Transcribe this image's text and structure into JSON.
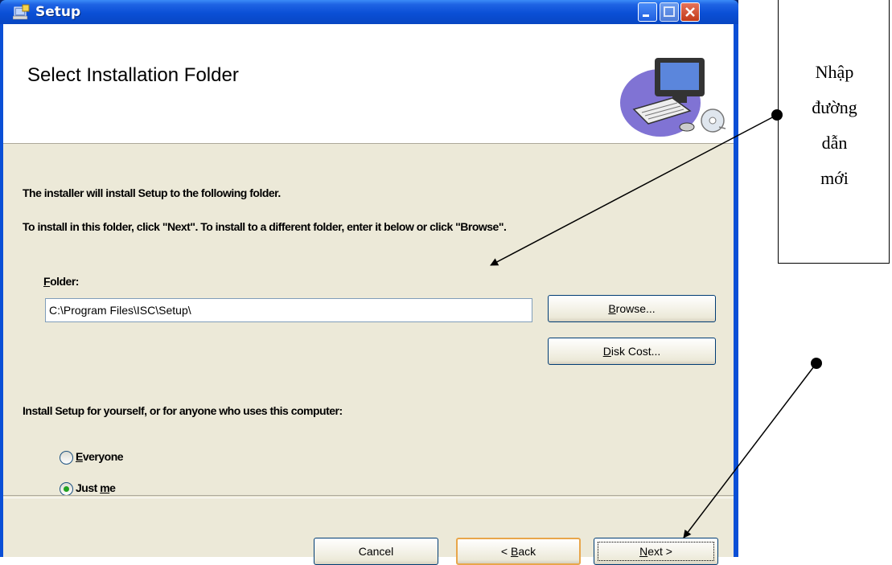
{
  "window": {
    "title": "Setup",
    "banner_title": "Select Installation Folder",
    "intro_line_1": "The installer will install Setup to the following folder.",
    "intro_line_2": "To install in this folder, click \"Next\". To install to a different folder, enter it below or click \"Browse\".",
    "folder_label_accel": "F",
    "folder_label_rest": "older:",
    "folder_value": "C:\\Program Files\\ISC\\Setup\\",
    "browse_accel": "B",
    "browse_rest": "rowse...",
    "diskcost_accel": "D",
    "diskcost_rest": "isk Cost...",
    "install_for_text": "Install Setup for yourself, or for anyone who uses this computer:",
    "radio_everyone_accel": "E",
    "radio_everyone_rest": "veryone",
    "radio_justme_pre": "Just ",
    "radio_justme_accel": "m",
    "radio_justme_post": "e",
    "selected_option": "Just me",
    "cancel_label": "Cancel",
    "back_pre": "< ",
    "back_accel": "B",
    "back_rest": "ack",
    "next_accel": "N",
    "next_rest": "ext >"
  },
  "callout": {
    "lines": [
      "Nhập",
      "đường",
      "dẫn",
      "mới"
    ]
  },
  "colors": {
    "titlebar": "#0a4fd6",
    "dialog_bg": "#ece9d8",
    "close_button": "#c23a18",
    "radio_selected": "#21a121"
  }
}
